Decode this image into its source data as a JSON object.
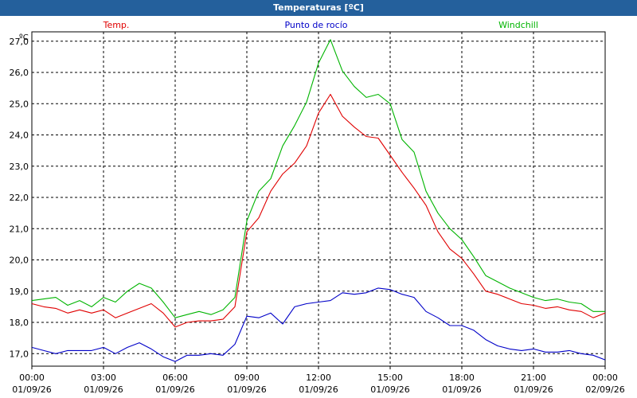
{
  "window": {
    "title": "Temperaturas [ºC]"
  },
  "chart_data": {
    "type": "line",
    "title": "Temperaturas [ºC]",
    "ylabel": "ºC",
    "xlabel": "",
    "ylim": [
      16.6,
      27.3
    ],
    "xlim": [
      0,
      24
    ],
    "grid": true,
    "legend_placement": "top",
    "yticks": [
      "17,0",
      "18,0",
      "19,0",
      "20,0",
      "21,0",
      "22,0",
      "23,0",
      "24,0",
      "25,0",
      "26,0",
      "27,0"
    ],
    "xticks": [
      {
        "time": "00:00",
        "date": "01/09/26"
      },
      {
        "time": "03:00",
        "date": "01/09/26"
      },
      {
        "time": "06:00",
        "date": "01/09/26"
      },
      {
        "time": "09:00",
        "date": "01/09/26"
      },
      {
        "time": "12:00",
        "date": "01/09/26"
      },
      {
        "time": "15:00",
        "date": "01/09/26"
      },
      {
        "time": "18:00",
        "date": "01/09/26"
      },
      {
        "time": "21:00",
        "date": "01/09/26"
      },
      {
        "time": "00:00",
        "date": "02/09/26"
      }
    ],
    "x": [
      0,
      0.5,
      1,
      1.5,
      2,
      2.5,
      3,
      3.5,
      4,
      4.5,
      5,
      5.5,
      6,
      6.5,
      7,
      7.5,
      8,
      8.5,
      9,
      9.5,
      10,
      10.5,
      11,
      11.5,
      12,
      12.5,
      13,
      13.5,
      14,
      14.5,
      15,
      15.5,
      16,
      16.5,
      17,
      17.5,
      18,
      18.5,
      19,
      19.5,
      20,
      20.5,
      21,
      21.5,
      22,
      22.5,
      23,
      23.5,
      24
    ],
    "series": [
      {
        "name": "Temp.",
        "color": "#e00000",
        "values": [
          18.6,
          18.5,
          18.45,
          18.3,
          18.4,
          18.3,
          18.4,
          18.15,
          18.3,
          18.45,
          18.6,
          18.3,
          17.85,
          18.0,
          18.05,
          18.05,
          18.1,
          18.5,
          20.9,
          21.35,
          22.2,
          22.75,
          23.1,
          23.65,
          24.7,
          25.3,
          24.6,
          24.25,
          23.95,
          23.9,
          23.35,
          22.8,
          22.3,
          21.75,
          20.9,
          20.35,
          20.05,
          19.55,
          19.0,
          18.9,
          18.75,
          18.6,
          18.55,
          18.45,
          18.5,
          18.4,
          18.35,
          18.15,
          18.3
        ]
      },
      {
        "name": "Punto de rocío",
        "color": "#0000c8",
        "values": [
          17.2,
          17.1,
          17.0,
          17.1,
          17.1,
          17.1,
          17.2,
          17.0,
          17.2,
          17.35,
          17.15,
          16.9,
          16.75,
          16.95,
          16.95,
          17.0,
          16.95,
          17.3,
          18.2,
          18.15,
          18.3,
          17.95,
          18.5,
          18.6,
          18.65,
          18.7,
          18.95,
          18.9,
          18.95,
          19.1,
          19.05,
          18.9,
          18.8,
          18.35,
          18.15,
          17.9,
          17.9,
          17.75,
          17.45,
          17.25,
          17.15,
          17.1,
          17.15,
          17.05,
          17.05,
          17.1,
          17.0,
          16.95,
          16.8
        ]
      },
      {
        "name": "Windchill",
        "color": "#00b400",
        "values": [
          18.7,
          18.75,
          18.8,
          18.55,
          18.7,
          18.5,
          18.8,
          18.65,
          19.0,
          19.25,
          19.1,
          18.65,
          18.15,
          18.25,
          18.35,
          18.25,
          18.4,
          18.8,
          21.25,
          22.2,
          22.6,
          23.65,
          24.3,
          25.05,
          26.3,
          27.05,
          26.05,
          25.55,
          25.2,
          25.3,
          25.0,
          23.85,
          23.45,
          22.2,
          21.5,
          21.0,
          20.65,
          20.1,
          19.5,
          19.3,
          19.1,
          18.95,
          18.8,
          18.7,
          18.75,
          18.65,
          18.6,
          18.35,
          18.35
        ]
      }
    ]
  }
}
